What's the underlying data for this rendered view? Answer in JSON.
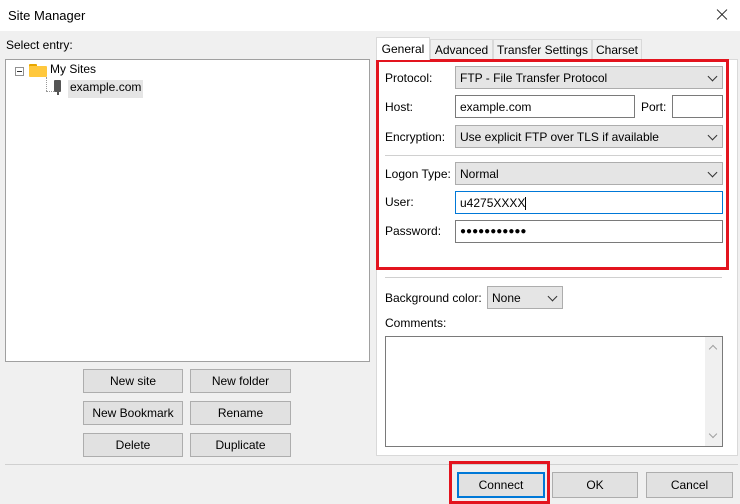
{
  "window": {
    "title": "Site Manager"
  },
  "left": {
    "select_entry_label": "Select entry:",
    "tree": {
      "folder": "My Sites",
      "site": "example.com"
    },
    "buttons": {
      "new_site": "New site",
      "new_folder": "New folder",
      "new_bookmark": "New Bookmark",
      "rename": "Rename",
      "delete": "Delete",
      "duplicate": "Duplicate"
    }
  },
  "tabs": [
    "General",
    "Advanced",
    "Transfer Settings",
    "Charset"
  ],
  "general": {
    "protocol_label": "Protocol:",
    "protocol_value": "FTP - File Transfer Protocol",
    "host_label": "Host:",
    "host_value": "example.com",
    "port_label": "Port:",
    "port_value": "",
    "encryption_label": "Encryption:",
    "encryption_value": "Use explicit FTP over TLS if available",
    "logon_type_label": "Logon Type:",
    "logon_type_value": "Normal",
    "user_label": "User:",
    "user_value": "u4275XXXX",
    "password_label": "Password:",
    "password_value": "●●●●●●●●●●●",
    "background_color_label": "Background color:",
    "background_color_value": "None",
    "comments_label": "Comments:",
    "comments_value": ""
  },
  "footer": {
    "connect": "Connect",
    "ok": "OK",
    "cancel": "Cancel"
  },
  "colors": {
    "highlight": "#e3141e",
    "focus": "#0078d7"
  }
}
